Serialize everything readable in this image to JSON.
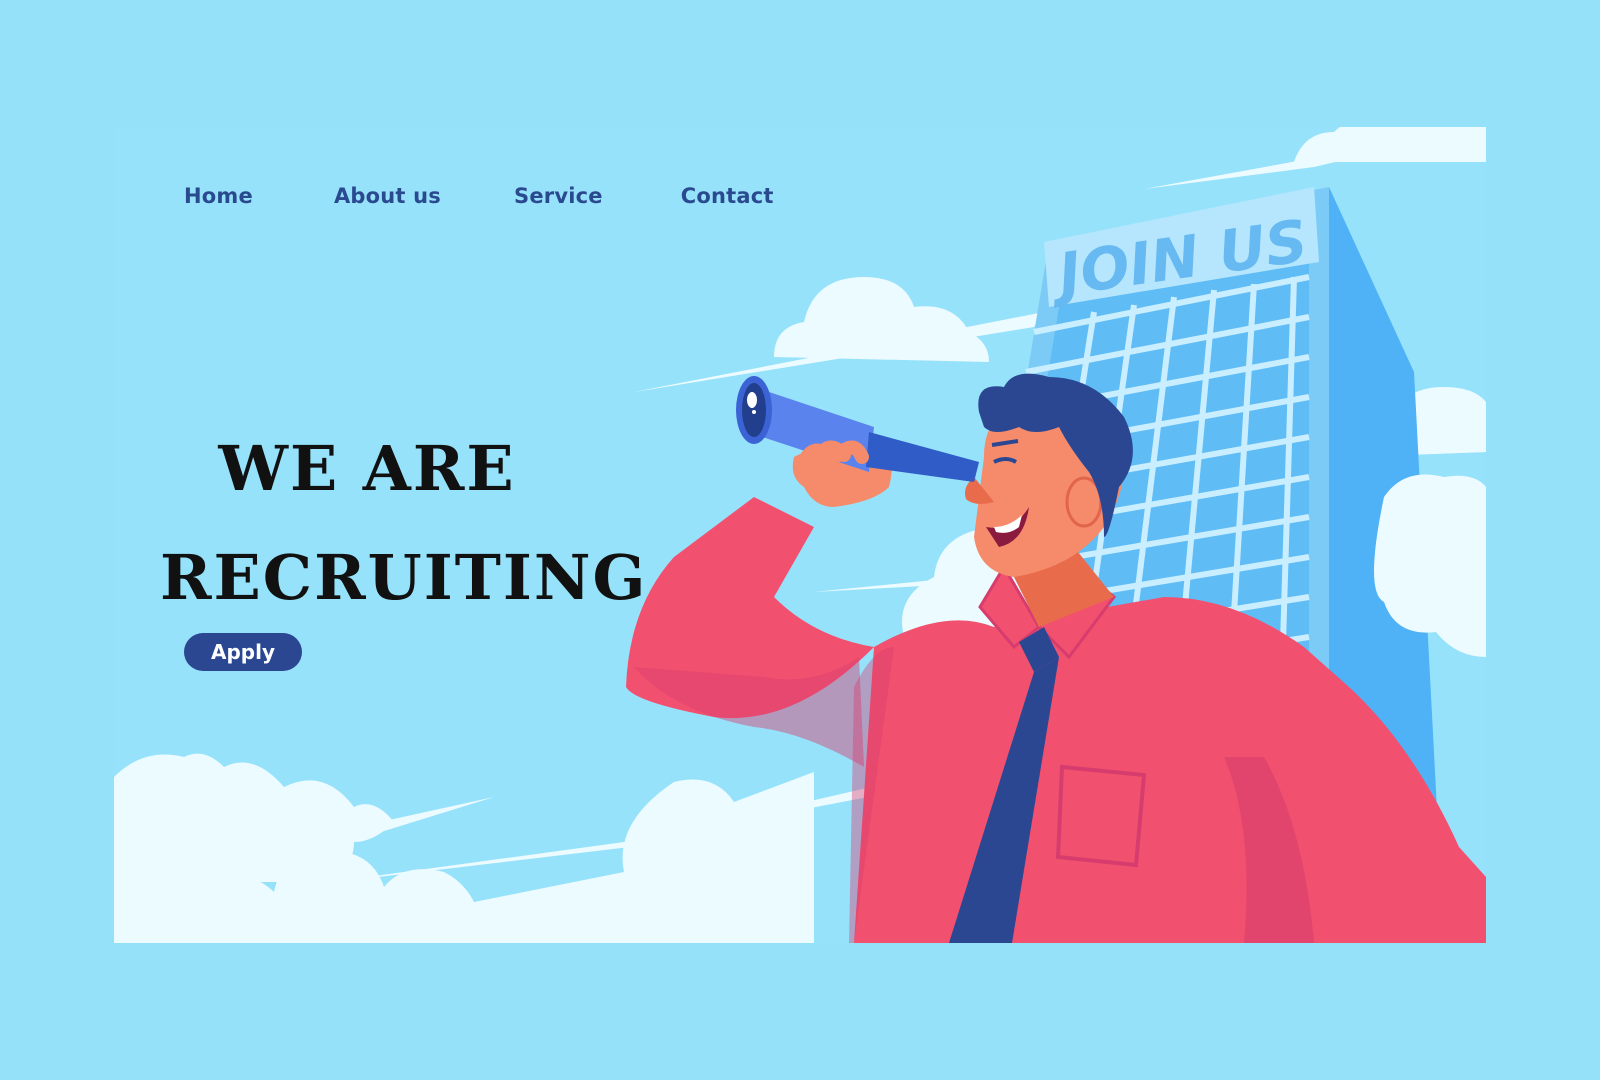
{
  "nav": {
    "items": [
      {
        "label": "Home"
      },
      {
        "label": "About us"
      },
      {
        "label": "Service"
      },
      {
        "label": "Contact"
      }
    ]
  },
  "hero": {
    "headline_line1": "WE ARE",
    "headline_line2": "RECRUITING",
    "apply_label": "Apply",
    "building_sign": "JOIN US"
  },
  "colors": {
    "page_background": "#96e1fa",
    "nav_text": "#2a4a8f",
    "headline_text": "#111111",
    "button_background": "#2b4792",
    "shirt": "#f2506f",
    "tie": "#2b4792",
    "telescope": "#5b83ee",
    "building": "#62b8f4",
    "clouds": "#ecfbff"
  },
  "icons": {
    "illustration": "man-with-telescope-illustration",
    "building": "office-building-icon"
  }
}
